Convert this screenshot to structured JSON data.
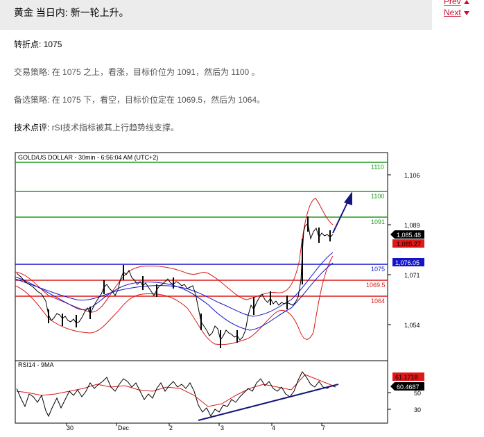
{
  "header": {
    "title": "黄金 当日内: 新一轮上升。",
    "prev_label": "Prev",
    "next_label": "Next"
  },
  "article": {
    "pivot_label": "转折点:",
    "pivot_value": "1075",
    "strategy_label": "交易策略:",
    "strategy_text": "在 1075 之上，看涨，目标价位为 1091，然后为 1100 。",
    "alt_label": "备选策略:",
    "alt_text": "在 1075 下，看空，目标价位定在 1069.5，然后为 1064。",
    "comment_label": "技术点评:",
    "comment_text": "rSI技术指标被其上行趋势线支撑。"
  },
  "chart": {
    "title": "GOLD/US DOLLAR - 30min - 6:56:04 AM (UTC+2)",
    "price_axis_ticks": [
      "1,106",
      "1,089",
      "1,071",
      "1,054"
    ],
    "levels": [
      {
        "label": "1110",
        "color": "#1f9a1f"
      },
      {
        "label": "1100",
        "color": "#1f9a1f"
      },
      {
        "label": "1091",
        "color": "#1f9a1f"
      },
      {
        "label": "1075",
        "color": "#1515c8"
      },
      {
        "label": "1069.5",
        "color": "#d81818"
      },
      {
        "label": "1064",
        "color": "#d81818"
      }
    ],
    "price_badges": [
      "1,085.48",
      "1,085.27",
      "1,076.05"
    ],
    "rsi_title": "RSI14 - 9MA",
    "rsi_axis_ticks": [
      "50",
      "30"
    ],
    "rsi_badges": [
      "61.1718",
      "60.4687"
    ],
    "x_ticks": [
      "30",
      "Dec",
      "2",
      "3",
      "4",
      "7"
    ]
  },
  "colors": {
    "accent_red": "#c8102e",
    "candle": "#000000",
    "bollinger": "#d81818",
    "ma": "#1515c8",
    "trend_arrow": "#15157a"
  }
}
